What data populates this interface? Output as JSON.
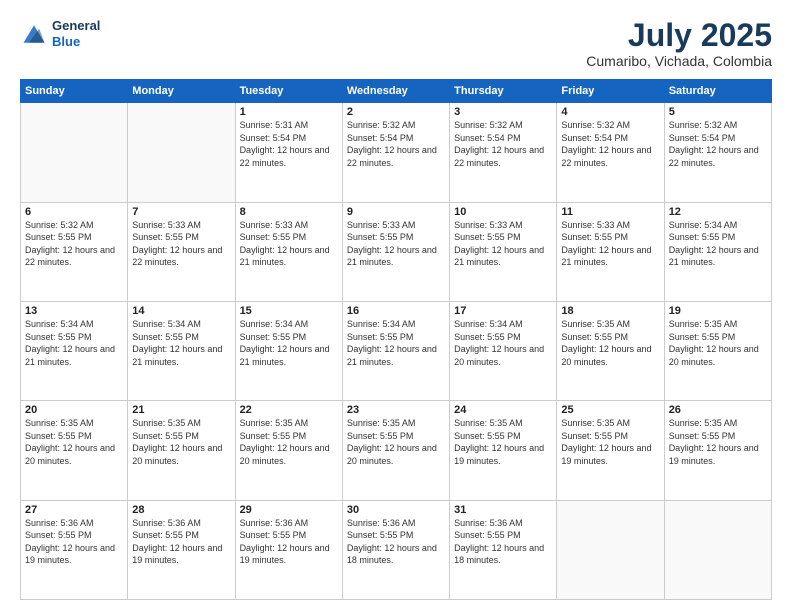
{
  "logo": {
    "line1": "General",
    "line2": "Blue"
  },
  "title": "July 2025",
  "subtitle": "Cumaribo, Vichada, Colombia",
  "header_days": [
    "Sunday",
    "Monday",
    "Tuesday",
    "Wednesday",
    "Thursday",
    "Friday",
    "Saturday"
  ],
  "weeks": [
    [
      {
        "day": "",
        "sunrise": "",
        "sunset": "",
        "daylight": "",
        "empty": true
      },
      {
        "day": "",
        "sunrise": "",
        "sunset": "",
        "daylight": "",
        "empty": true
      },
      {
        "day": "1",
        "sunrise": "Sunrise: 5:31 AM",
        "sunset": "Sunset: 5:54 PM",
        "daylight": "Daylight: 12 hours and 22 minutes."
      },
      {
        "day": "2",
        "sunrise": "Sunrise: 5:32 AM",
        "sunset": "Sunset: 5:54 PM",
        "daylight": "Daylight: 12 hours and 22 minutes."
      },
      {
        "day": "3",
        "sunrise": "Sunrise: 5:32 AM",
        "sunset": "Sunset: 5:54 PM",
        "daylight": "Daylight: 12 hours and 22 minutes."
      },
      {
        "day": "4",
        "sunrise": "Sunrise: 5:32 AM",
        "sunset": "Sunset: 5:54 PM",
        "daylight": "Daylight: 12 hours and 22 minutes."
      },
      {
        "day": "5",
        "sunrise": "Sunrise: 5:32 AM",
        "sunset": "Sunset: 5:54 PM",
        "daylight": "Daylight: 12 hours and 22 minutes."
      }
    ],
    [
      {
        "day": "6",
        "sunrise": "Sunrise: 5:32 AM",
        "sunset": "Sunset: 5:55 PM",
        "daylight": "Daylight: 12 hours and 22 minutes."
      },
      {
        "day": "7",
        "sunrise": "Sunrise: 5:33 AM",
        "sunset": "Sunset: 5:55 PM",
        "daylight": "Daylight: 12 hours and 22 minutes."
      },
      {
        "day": "8",
        "sunrise": "Sunrise: 5:33 AM",
        "sunset": "Sunset: 5:55 PM",
        "daylight": "Daylight: 12 hours and 21 minutes."
      },
      {
        "day": "9",
        "sunrise": "Sunrise: 5:33 AM",
        "sunset": "Sunset: 5:55 PM",
        "daylight": "Daylight: 12 hours and 21 minutes."
      },
      {
        "day": "10",
        "sunrise": "Sunrise: 5:33 AM",
        "sunset": "Sunset: 5:55 PM",
        "daylight": "Daylight: 12 hours and 21 minutes."
      },
      {
        "day": "11",
        "sunrise": "Sunrise: 5:33 AM",
        "sunset": "Sunset: 5:55 PM",
        "daylight": "Daylight: 12 hours and 21 minutes."
      },
      {
        "day": "12",
        "sunrise": "Sunrise: 5:34 AM",
        "sunset": "Sunset: 5:55 PM",
        "daylight": "Daylight: 12 hours and 21 minutes."
      }
    ],
    [
      {
        "day": "13",
        "sunrise": "Sunrise: 5:34 AM",
        "sunset": "Sunset: 5:55 PM",
        "daylight": "Daylight: 12 hours and 21 minutes."
      },
      {
        "day": "14",
        "sunrise": "Sunrise: 5:34 AM",
        "sunset": "Sunset: 5:55 PM",
        "daylight": "Daylight: 12 hours and 21 minutes."
      },
      {
        "day": "15",
        "sunrise": "Sunrise: 5:34 AM",
        "sunset": "Sunset: 5:55 PM",
        "daylight": "Daylight: 12 hours and 21 minutes."
      },
      {
        "day": "16",
        "sunrise": "Sunrise: 5:34 AM",
        "sunset": "Sunset: 5:55 PM",
        "daylight": "Daylight: 12 hours and 21 minutes."
      },
      {
        "day": "17",
        "sunrise": "Sunrise: 5:34 AM",
        "sunset": "Sunset: 5:55 PM",
        "daylight": "Daylight: 12 hours and 20 minutes."
      },
      {
        "day": "18",
        "sunrise": "Sunrise: 5:35 AM",
        "sunset": "Sunset: 5:55 PM",
        "daylight": "Daylight: 12 hours and 20 minutes."
      },
      {
        "day": "19",
        "sunrise": "Sunrise: 5:35 AM",
        "sunset": "Sunset: 5:55 PM",
        "daylight": "Daylight: 12 hours and 20 minutes."
      }
    ],
    [
      {
        "day": "20",
        "sunrise": "Sunrise: 5:35 AM",
        "sunset": "Sunset: 5:55 PM",
        "daylight": "Daylight: 12 hours and 20 minutes."
      },
      {
        "day": "21",
        "sunrise": "Sunrise: 5:35 AM",
        "sunset": "Sunset: 5:55 PM",
        "daylight": "Daylight: 12 hours and 20 minutes."
      },
      {
        "day": "22",
        "sunrise": "Sunrise: 5:35 AM",
        "sunset": "Sunset: 5:55 PM",
        "daylight": "Daylight: 12 hours and 20 minutes."
      },
      {
        "day": "23",
        "sunrise": "Sunrise: 5:35 AM",
        "sunset": "Sunset: 5:55 PM",
        "daylight": "Daylight: 12 hours and 20 minutes."
      },
      {
        "day": "24",
        "sunrise": "Sunrise: 5:35 AM",
        "sunset": "Sunset: 5:55 PM",
        "daylight": "Daylight: 12 hours and 19 minutes."
      },
      {
        "day": "25",
        "sunrise": "Sunrise: 5:35 AM",
        "sunset": "Sunset: 5:55 PM",
        "daylight": "Daylight: 12 hours and 19 minutes."
      },
      {
        "day": "26",
        "sunrise": "Sunrise: 5:35 AM",
        "sunset": "Sunset: 5:55 PM",
        "daylight": "Daylight: 12 hours and 19 minutes."
      }
    ],
    [
      {
        "day": "27",
        "sunrise": "Sunrise: 5:36 AM",
        "sunset": "Sunset: 5:55 PM",
        "daylight": "Daylight: 12 hours and 19 minutes."
      },
      {
        "day": "28",
        "sunrise": "Sunrise: 5:36 AM",
        "sunset": "Sunset: 5:55 PM",
        "daylight": "Daylight: 12 hours and 19 minutes."
      },
      {
        "day": "29",
        "sunrise": "Sunrise: 5:36 AM",
        "sunset": "Sunset: 5:55 PM",
        "daylight": "Daylight: 12 hours and 19 minutes."
      },
      {
        "day": "30",
        "sunrise": "Sunrise: 5:36 AM",
        "sunset": "Sunset: 5:55 PM",
        "daylight": "Daylight: 12 hours and 18 minutes."
      },
      {
        "day": "31",
        "sunrise": "Sunrise: 5:36 AM",
        "sunset": "Sunset: 5:55 PM",
        "daylight": "Daylight: 12 hours and 18 minutes."
      },
      {
        "day": "",
        "sunrise": "",
        "sunset": "",
        "daylight": "",
        "empty": true
      },
      {
        "day": "",
        "sunrise": "",
        "sunset": "",
        "daylight": "",
        "empty": true
      }
    ]
  ]
}
